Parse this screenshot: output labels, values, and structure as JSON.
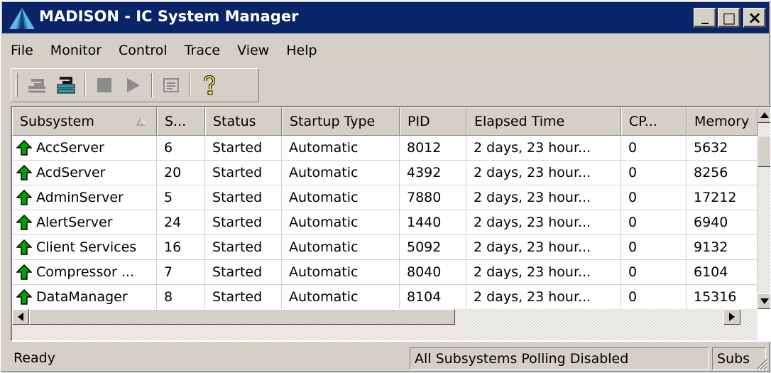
{
  "window": {
    "title": "MADISON - IC System Manager",
    "buttons": {
      "minimize": "_",
      "maximize": "□",
      "close": "×"
    }
  },
  "menu": [
    {
      "label": "File"
    },
    {
      "label": "Monitor"
    },
    {
      "label": "Control"
    },
    {
      "label": "Trace"
    },
    {
      "label": "View"
    },
    {
      "label": "Help"
    }
  ],
  "toolbar": {
    "icons": [
      "back-icon",
      "refresh-icon",
      "stop-icon",
      "play-icon",
      "properties-icon",
      "help-icon"
    ]
  },
  "table": {
    "columns": [
      "Subsystem",
      "S...",
      "Status",
      "Startup Type",
      "PID",
      "Elapsed Time",
      "CP...",
      "Memory"
    ],
    "rows": [
      {
        "name": "AccServer",
        "s": "6",
        "status": "Started",
        "startup": "Automatic",
        "pid": "8012",
        "elapsed": "2 days, 23 hour...",
        "cpu": "0",
        "memory": "5632"
      },
      {
        "name": "AcdServer",
        "s": "20",
        "status": "Started",
        "startup": "Automatic",
        "pid": "4392",
        "elapsed": "2 days, 23 hour...",
        "cpu": "0",
        "memory": "8256"
      },
      {
        "name": "AdminServer",
        "s": "5",
        "status": "Started",
        "startup": "Automatic",
        "pid": "7880",
        "elapsed": "2 days, 23 hour...",
        "cpu": "0",
        "memory": "17212"
      },
      {
        "name": "AlertServer",
        "s": "24",
        "status": "Started",
        "startup": "Automatic",
        "pid": "1440",
        "elapsed": "2 days, 23 hour...",
        "cpu": "0",
        "memory": "6940"
      },
      {
        "name": "Client Services",
        "s": "16",
        "status": "Started",
        "startup": "Automatic",
        "pid": "5092",
        "elapsed": "2 days, 23 hour...",
        "cpu": "0",
        "memory": "9132"
      },
      {
        "name": "Compressor ...",
        "s": "7",
        "status": "Started",
        "startup": "Automatic",
        "pid": "8040",
        "elapsed": "2 days, 23 hour...",
        "cpu": "0",
        "memory": "6104"
      },
      {
        "name": "DataManager",
        "s": "8",
        "status": "Started",
        "startup": "Automatic",
        "pid": "8104",
        "elapsed": "2 days, 23 hour...",
        "cpu": "0",
        "memory": "15316"
      }
    ]
  },
  "status": {
    "left": "Ready",
    "middle": "All Subsystems Polling Disabled",
    "right": "Subs"
  },
  "colors": {
    "titlebar": "#0a246a",
    "face": "#d4d0c8",
    "status_icon": "#00a000"
  }
}
